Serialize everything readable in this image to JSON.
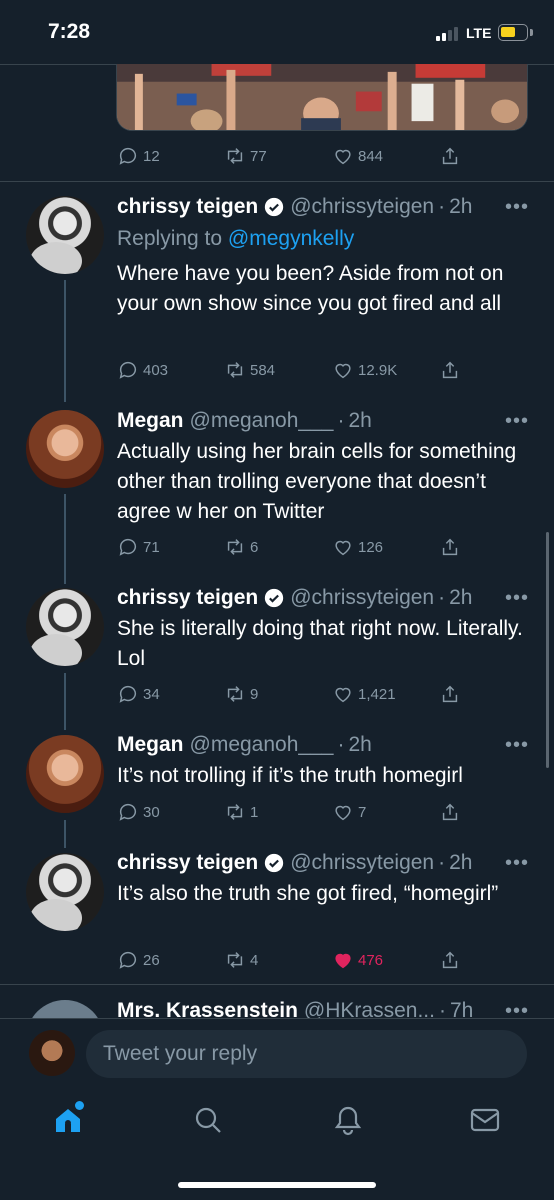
{
  "status_bar": {
    "time": "7:28",
    "network": "LTE"
  },
  "top_tweet_actions": {
    "replies": "12",
    "retweets": "77",
    "likes": "844"
  },
  "tweets": [
    {
      "name": "chrissy teigen",
      "verified": true,
      "handle": "@chrissyteigen",
      "time": "2h",
      "replying_prefix": "Replying to ",
      "replying_to": "@megynkelly",
      "text": "Where have you been? Aside from not on your own show since you got fired and all",
      "replies": "403",
      "retweets": "584",
      "likes": "12.9K"
    },
    {
      "name": "Megan",
      "verified": false,
      "handle": "@meganoh___",
      "time": "2h",
      "text": "Actually using her brain cells for something other than trolling everyone that doesn’t agree w her on Twitter",
      "replies": "71",
      "retweets": "6",
      "likes": "126"
    },
    {
      "name": "chrissy teigen",
      "verified": true,
      "handle": "@chrissyteigen",
      "time": "2h",
      "text": "She is literally doing that right now. Literally. Lol",
      "replies": "34",
      "retweets": "9",
      "likes": "1,421"
    },
    {
      "name": "Megan",
      "verified": false,
      "handle": "@meganoh___",
      "time": "2h",
      "text": "It’s not trolling if it’s the truth homegirl",
      "replies": "30",
      "retweets": "1",
      "likes": "7"
    },
    {
      "name": "chrissy teigen",
      "verified": true,
      "handle": "@chrissyteigen",
      "time": "2h",
      "text": "It’s also the truth she got fired, “homegirl”",
      "replies": "26",
      "retweets": "4",
      "likes": "476",
      "liked": true
    },
    {
      "name": "Mrs. Krassenstein",
      "verified": false,
      "handle": "@HKrassen...",
      "time": "7h"
    }
  ],
  "reply_bar": {
    "placeholder": "Tweet your reply"
  },
  "tab_bar": {
    "items": [
      "home-icon",
      "search-icon",
      "notifications-icon",
      "messages-icon"
    ]
  },
  "colors": {
    "background": "#15202b",
    "accent": "#1da1f2",
    "like": "#e0245e",
    "muted": "#8899a6",
    "verified": "#ffffff"
  }
}
